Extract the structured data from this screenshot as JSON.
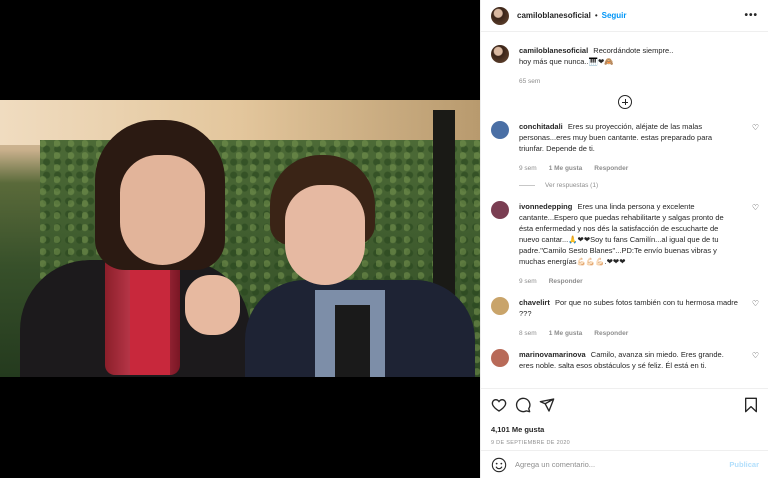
{
  "post": {
    "username": "camiloblanesoficial",
    "follow_label": "Seguir",
    "more_label": "•••",
    "caption": "Recordándote siempre..",
    "caption_line2": "hoy más que nunca..",
    "caption_emoji": "🎹❤🙈",
    "caption_time": "65 sem"
  },
  "comments": [
    {
      "user": "conchitadali",
      "text": "Eres su proyección, aléjate de las malas personas...eres muy buen cantante. estas preparado para triunfar. Depende de ti.",
      "time": "9 sem",
      "likes": "1 Me gusta",
      "reply": "Responder",
      "view_replies": "Ver respuestas (1)",
      "avatar_color": "#4a6fa5"
    },
    {
      "user": "ivonnedepping",
      "text": "Eres una linda persona y excelente cantante...Espero que puedas rehabilitarte y salgas pronto de ésta enfermedad y nos dés la satisfacción de escucharte de nuevo cantar...🙏❤❤Soy tu fans Camilín...al igual que de tu padre.\"Camilo Sesto Blanes\"...PD:Te envío buenas vibras y muchas energías💪🏻💪🏻💪🏻.❤❤❤",
      "time": "9 sem",
      "reply": "Responder",
      "avatar_color": "#7a3e52"
    },
    {
      "user": "chavelirt",
      "text": "Por que no subes fotos también con tu hermosa madre ???",
      "time": "8 sem",
      "likes": "1 Me gusta",
      "reply": "Responder",
      "avatar_color": "#c9a46a"
    },
    {
      "user": "marinovamarinova",
      "text": "Camilo, avanza sin miedo. Eres grande. eres noble. salta esos obstáculos y sé feliz. Él está en ti.",
      "avatar_color": "#b86a58"
    }
  ],
  "actions": {
    "likes": "4,101 Me gusta",
    "date": "9 DE SEPTIEMBRE DE 2020",
    "add_comment_placeholder": "Agrega un comentario...",
    "publish_label": "Publicar"
  }
}
